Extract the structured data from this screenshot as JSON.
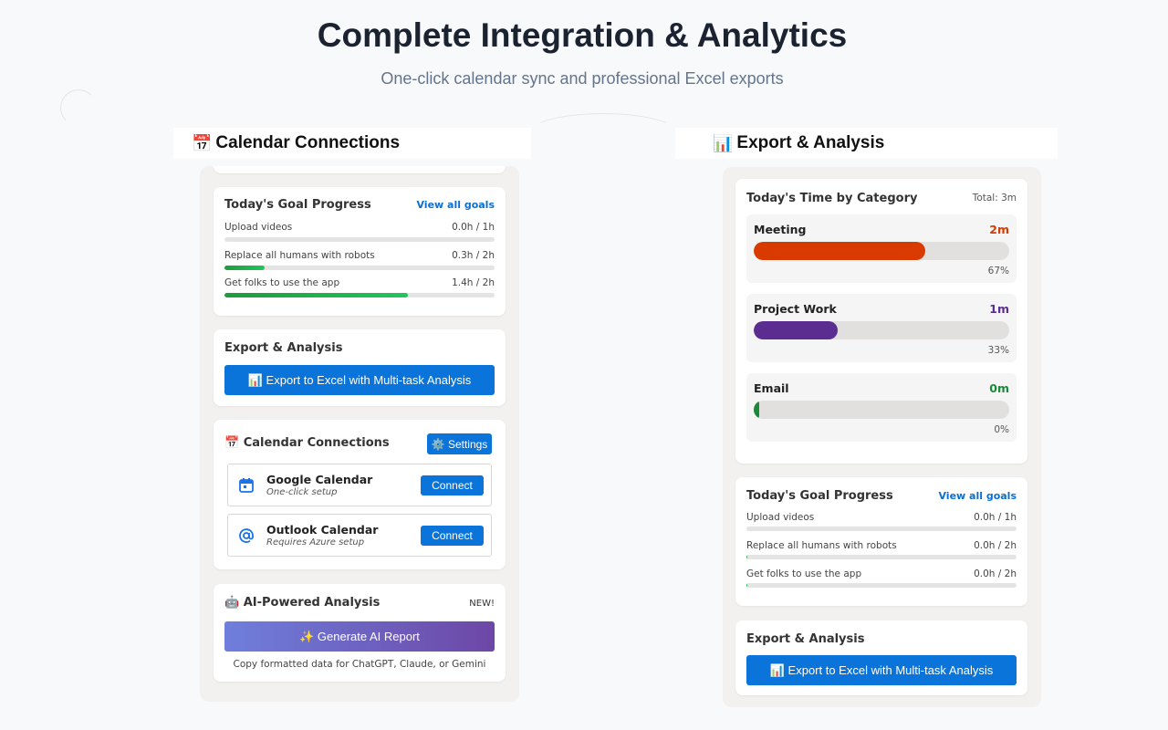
{
  "hero": {
    "title": "Complete Integration & Analytics",
    "subtitle": "One-click calendar sync and professional Excel exports"
  },
  "left_section": {
    "icon": "calendar-emoji",
    "emoji": "📅",
    "title": "Calendar Connections",
    "goals": {
      "title": "Today's Goal Progress",
      "link": "View all goals",
      "items": [
        {
          "label": "Upload videos",
          "value": "0.0h / 1h",
          "progress": 0.0
        },
        {
          "label": "Replace all humans with robots",
          "value": "0.3h / 2h",
          "progress": 0.15
        },
        {
          "label": "Get folks to use the app",
          "value": "1.4h / 2h",
          "progress": 0.68
        }
      ]
    },
    "export": {
      "title": "Export & Analysis",
      "button": "📊 Export to Excel with Multi-task Analysis"
    },
    "calendars": {
      "title": "📅 Calendar Connections",
      "settings": "⚙️ Settings",
      "items": [
        {
          "name": "Google Calendar",
          "desc": "One-click setup",
          "button": "Connect",
          "icon": "calendar-icon"
        },
        {
          "name": "Outlook Calendar",
          "desc": "Requires Azure setup",
          "button": "Connect",
          "icon": "at-sign-icon"
        }
      ]
    },
    "ai": {
      "title": "🤖 AI-Powered Analysis",
      "badge": "NEW!",
      "button": "✨ Generate AI Report",
      "caption": "Copy formatted data for ChatGPT, Claude, or Gemini"
    }
  },
  "right_section": {
    "icon": "chart-emoji",
    "emoji": "📊",
    "title": "Export & Analysis",
    "categories": {
      "title": "Today's Time by Category",
      "total": "Total: 3m",
      "items": [
        {
          "name": "Meeting",
          "time": "2m",
          "percent": "67%",
          "fraction": 0.67,
          "color": "#d93a00"
        },
        {
          "name": "Project Work",
          "time": "1m",
          "percent": "33%",
          "fraction": 0.33,
          "color": "#5b2d91"
        },
        {
          "name": "Email",
          "time": "0m",
          "percent": "0%",
          "fraction": 0.02,
          "color": "#1a8a3a"
        }
      ]
    },
    "goals": {
      "title": "Today's Goal Progress",
      "link": "View all goals",
      "items": [
        {
          "label": "Upload videos",
          "value": "0.0h / 1h",
          "progress": 0.0
        },
        {
          "label": "Replace all humans with robots",
          "value": "0.0h / 2h",
          "progress": 0.003
        },
        {
          "label": "Get folks to use the app",
          "value": "0.0h / 2h",
          "progress": 0.003
        }
      ]
    },
    "export": {
      "title": "Export & Analysis",
      "button": "📊 Export to Excel with Multi-task Analysis"
    }
  }
}
